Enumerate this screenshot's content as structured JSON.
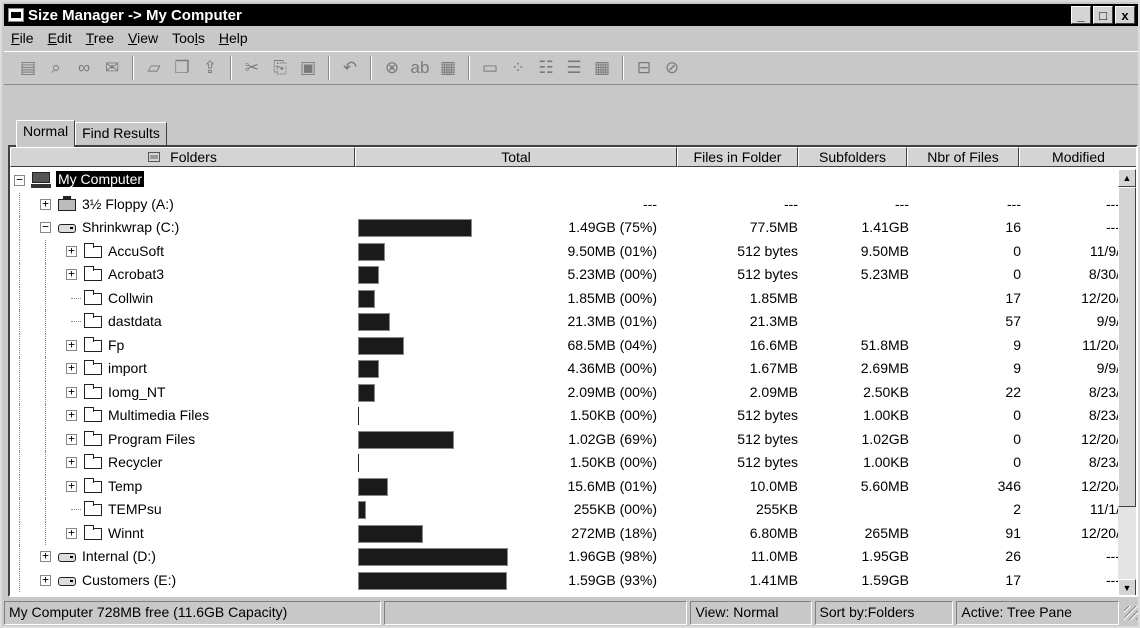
{
  "window": {
    "title": "Size Manager -> My Computer",
    "minimize": "_",
    "maximize": "□",
    "close": "x"
  },
  "menu": [
    {
      "label": "File",
      "key": "F",
      "rest": "ile"
    },
    {
      "label": "Edit",
      "key": "E",
      "rest": "dit"
    },
    {
      "label": "Tree",
      "key": "T",
      "rest": "ree"
    },
    {
      "label": "View",
      "key": "V",
      "rest": "iew"
    },
    {
      "label": "Tools",
      "pre": "Too",
      "key": "l",
      "rest": "s"
    },
    {
      "label": "Help",
      "key": "H",
      "rest": "elp"
    }
  ],
  "toolbar": {
    "icons": [
      "properties-icon",
      "find-icon",
      "binoculars-icon",
      "envelope-icon",
      "open-folder-icon",
      "copy-to-icon",
      "move-to-icon",
      "cut-icon",
      "copy-icon",
      "paste-icon",
      "undo-icon",
      "delete-icon",
      "rename-icon",
      "properties-sheet-icon",
      "view-one-icon",
      "view-small-icons-icon",
      "view-list-icon",
      "view-details-icon",
      "view-grid-icon",
      "map-drive-icon",
      "disconnect-icon"
    ]
  },
  "tabs": [
    {
      "label": "Normal",
      "active": true
    },
    {
      "label": "Find Results",
      "active": false
    }
  ],
  "columns": {
    "folders": "Folders",
    "total": "Total",
    "files_in_folder": "Files in Folder",
    "subfolders": "Subfolders",
    "nbr_of_files": "Nbr of Files",
    "modified": "Modified"
  },
  "rows": [
    {
      "name": "My Computer",
      "type": "computer",
      "level": 0,
      "expander": "−",
      "selected": true,
      "bar_pct": 0,
      "total": "",
      "files": "",
      "sub": "",
      "nbr": "",
      "mod": ""
    },
    {
      "name": "3½ Floppy (A:)",
      "type": "floppy",
      "level": 1,
      "expander": "+",
      "bar_pct": -1,
      "total": "---",
      "files": "---",
      "sub": "---",
      "nbr": "---",
      "mod": "---"
    },
    {
      "name": "Shrinkwrap (C:)",
      "type": "drive",
      "level": 1,
      "expander": "−",
      "bar_pct": 75,
      "total": "1.49GB (75%)",
      "files": "77.5MB",
      "sub": "1.41GB",
      "nbr": "16",
      "mod": "---"
    },
    {
      "name": "AccuSoft",
      "type": "folder",
      "level": 2,
      "expander": "+",
      "bar_pct": 18,
      "total": "9.50MB (01%)",
      "files": "512 bytes",
      "sub": "9.50MB",
      "nbr": "0",
      "mod": "11/9/"
    },
    {
      "name": "Acrobat3",
      "type": "folder",
      "level": 2,
      "expander": "+",
      "bar_pct": 14,
      "total": "5.23MB (00%)",
      "files": "512 bytes",
      "sub": "5.23MB",
      "nbr": "0",
      "mod": "8/30/"
    },
    {
      "name": "Collwin",
      "type": "folder",
      "level": 2,
      "expander": "",
      "bar_pct": 11,
      "total": "1.85MB (00%)",
      "files": "1.85MB",
      "sub": "",
      "nbr": "17",
      "mod": "12/20/"
    },
    {
      "name": "dastdata",
      "type": "folder",
      "level": 2,
      "expander": "",
      "bar_pct": 21,
      "total": "21.3MB (01%)",
      "files": "21.3MB",
      "sub": "",
      "nbr": "57",
      "mod": "9/9/"
    },
    {
      "name": "Fp",
      "type": "folder",
      "level": 2,
      "expander": "+",
      "bar_pct": 30,
      "total": "68.5MB (04%)",
      "files": "16.6MB",
      "sub": "51.8MB",
      "nbr": "9",
      "mod": "11/20/"
    },
    {
      "name": "import",
      "type": "folder",
      "level": 2,
      "expander": "+",
      "bar_pct": 14,
      "total": "4.36MB (00%)",
      "files": "1.67MB",
      "sub": "2.69MB",
      "nbr": "9",
      "mod": "9/9/"
    },
    {
      "name": "Iomg_NT",
      "type": "folder",
      "level": 2,
      "expander": "+",
      "bar_pct": 11,
      "total": "2.09MB (00%)",
      "files": "2.09MB",
      "sub": "2.50KB",
      "nbr": "22",
      "mod": "8/23/"
    },
    {
      "name": "Multimedia Files",
      "type": "folder",
      "level": 2,
      "expander": "+",
      "bar_pct": 0,
      "total": "1.50KB (00%)",
      "files": "512 bytes",
      "sub": "1.00KB",
      "nbr": "0",
      "mod": "8/23/"
    },
    {
      "name": "Program Files",
      "type": "folder",
      "level": 2,
      "expander": "+",
      "bar_pct": 63,
      "total": "1.02GB (69%)",
      "files": "512 bytes",
      "sub": "1.02GB",
      "nbr": "0",
      "mod": "12/20/"
    },
    {
      "name": "Recycler",
      "type": "folder",
      "level": 2,
      "expander": "+",
      "bar_pct": 0,
      "total": "1.50KB (00%)",
      "files": "512 bytes",
      "sub": "1.00KB",
      "nbr": "0",
      "mod": "8/23/"
    },
    {
      "name": "Temp",
      "type": "folder",
      "level": 2,
      "expander": "+",
      "bar_pct": 20,
      "total": "15.6MB (01%)",
      "files": "10.0MB",
      "sub": "5.60MB",
      "nbr": "346",
      "mod": "12/20/"
    },
    {
      "name": "TEMPsu",
      "type": "folder",
      "level": 2,
      "expander": "",
      "bar_pct": 5,
      "total": "255KB (00%)",
      "files": "255KB",
      "sub": "",
      "nbr": "2",
      "mod": "11/1/"
    },
    {
      "name": "Winnt",
      "type": "folder",
      "level": 2,
      "expander": "+",
      "bar_pct": 43,
      "total": "272MB (18%)",
      "files": "6.80MB",
      "sub": "265MB",
      "nbr": "91",
      "mod": "12/20/"
    },
    {
      "name": "Internal (D:)",
      "type": "drive",
      "level": 1,
      "expander": "+",
      "bar_pct": 99,
      "total": "1.96GB (98%)",
      "files": "11.0MB",
      "sub": "1.95GB",
      "nbr": "26",
      "mod": "---"
    },
    {
      "name": "Customers (E:)",
      "type": "drive",
      "level": 1,
      "expander": "+",
      "bar_pct": 98,
      "total": "1.59GB (93%)",
      "files": "1.41MB",
      "sub": "1.59GB",
      "nbr": "17",
      "mod": "---"
    }
  ],
  "status": {
    "info": "My Computer  728MB free (11.6GB Capacity)",
    "blank": "",
    "view": "View: Normal",
    "sort": "Sort by:Folders",
    "active": "Active: Tree Pane"
  }
}
